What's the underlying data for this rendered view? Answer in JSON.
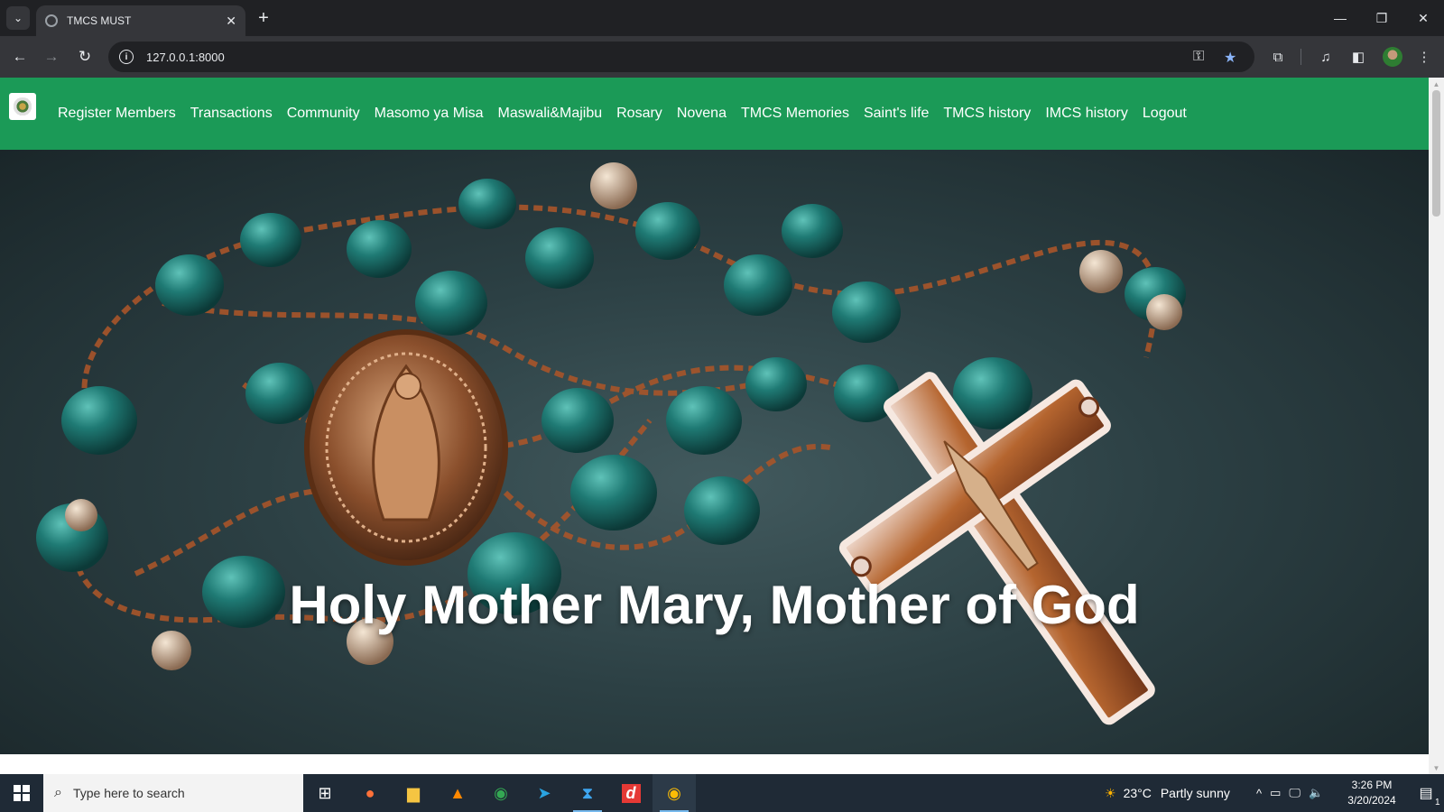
{
  "browser": {
    "tab_title": "TMCS MUST",
    "tab_close": "✕",
    "new_tab": "+",
    "url": "127.0.0.1:8000",
    "window_controls": {
      "minimize": "—",
      "restore": "❐",
      "close": "✕"
    }
  },
  "site": {
    "nav_links": [
      "Register Members",
      "Transactions",
      "Community",
      "Masomo ya Misa",
      "Maswali&Majibu",
      "Rosary",
      "Novena",
      "TMCS Memories",
      "Saint's life",
      "TMCS history",
      "IMCS history",
      "Logout"
    ],
    "hero_title": "Holy Mother Mary, Mother of God",
    "colors": {
      "nav_bg": "#1b9a57",
      "bead": "#1f7a74",
      "copper": "#a0522d"
    }
  },
  "taskbar": {
    "search_placeholder": "Type here to search",
    "weather_temp": "23°C",
    "weather_desc": "Partly sunny",
    "time": "3:26 PM",
    "date": "3/20/2024",
    "notification_count": "1"
  }
}
